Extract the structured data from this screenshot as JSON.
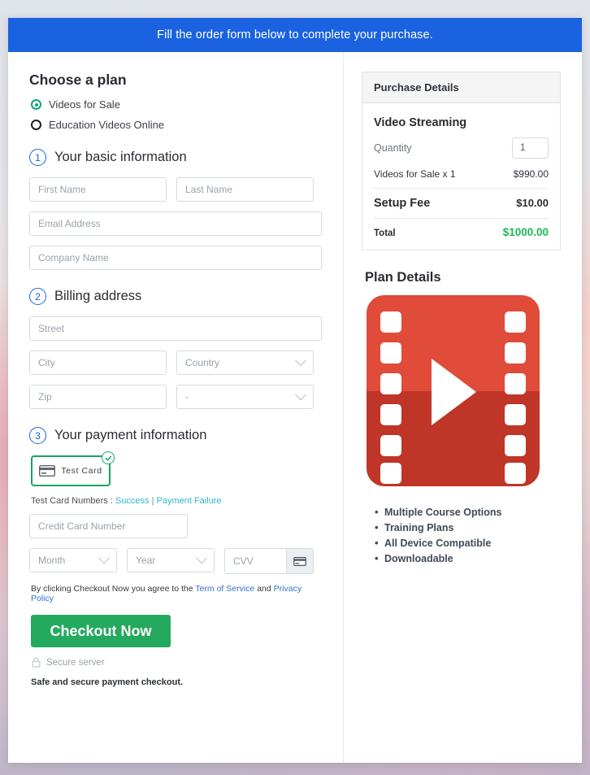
{
  "header": {
    "banner_text": "Fill the order form below to complete your purchase."
  },
  "plan": {
    "heading": "Choose a plan",
    "options": [
      {
        "label": "Videos for Sale",
        "selected": true
      },
      {
        "label": "Education Videos Online",
        "selected": false
      }
    ]
  },
  "steps": {
    "basic": {
      "number": "1",
      "title": "Your basic information"
    },
    "billing": {
      "number": "2",
      "title": "Billing address"
    },
    "payment": {
      "number": "3",
      "title": "Your payment information"
    }
  },
  "fields": {
    "first_name": "First Name",
    "last_name": "Last Name",
    "email": "Email Address",
    "company": "Company Name",
    "street": "Street",
    "city": "City",
    "country": "Country",
    "zip": "Zip",
    "state": "-",
    "credit_card_number": "Credit Card Number",
    "month": "Month",
    "year": "Year",
    "cvv": "CVV"
  },
  "payment": {
    "card_option_label": "Test Card",
    "test_prefix": "Test Card Numbers :",
    "test_success": "Success",
    "test_separator": "|",
    "test_failure": "Payment Failure",
    "agree_prefix": "By clicking Checkout Now you agree to the",
    "terms_link": "Term of Service",
    "agree_and": "and",
    "privacy_link": "Privacy Policy",
    "checkout_label": "Checkout Now",
    "secure_server": "Secure server",
    "safe_note": "Safe and secure payment checkout."
  },
  "purchase_details": {
    "panel_title": "Purchase Details",
    "product_title": "Video Streaming",
    "quantity_label": "Quantity",
    "quantity_value": "1",
    "line_item_label": "Videos for Sale x 1",
    "line_item_price": "$990.00",
    "setup_fee_label": "Setup Fee",
    "setup_fee_price": "$10.00",
    "total_label": "Total",
    "total_price": "$1000.00"
  },
  "plan_details": {
    "title": "Plan Details",
    "features": [
      "Multiple Course Options",
      "Training Plans",
      "All Device Compatible",
      "Downloadable"
    ]
  },
  "colors": {
    "banner_blue": "#1b62e0",
    "checkout_green": "#24a95e",
    "total_green": "#1db954",
    "link_teal": "#2fb8c6",
    "link_blue": "#2f6fd0",
    "film_red": "#d9422e"
  }
}
